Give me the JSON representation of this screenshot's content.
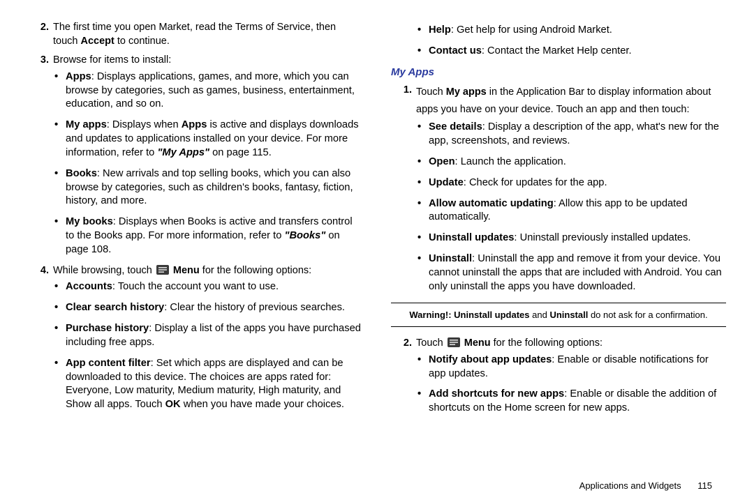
{
  "left": {
    "items": [
      {
        "num": "2.",
        "body_html": "The first time you open Market, read the Terms of Service, then touch <b>Accept</b> to continue."
      },
      {
        "num": "3.",
        "body_html": "Browse for items to install:",
        "bullets": [
          "<b>Apps</b>: Displays applications, games, and more, which you can browse by categories, such as games, business, entertainment, education, and so on.",
          "<b>My apps</b>: Displays when <b>Apps</b> is active and displays downloads and updates to applications installed on your device. For more information, refer to <i><b>\"My Apps\"</b></i> on page 115.",
          "<b>Books</b>: New arrivals and top selling books, which you can also browse by categories, such as children's books, fantasy, fiction, history, and more.",
          "<b>My books</b>: Displays when Books is active and transfers control to the Books app. For more information, refer to <i><b>\"Books\"</b></i> on page 108."
        ]
      },
      {
        "num": "4.",
        "body_pre": "While browsing, touch ",
        "menu_label": "Menu",
        "body_post": " for the following options:",
        "bullets": [
          "<b>Accounts</b>: Touch the account you want to use.",
          "<b>Clear search history</b>: Clear the history of previous searches.",
          "<b>Purchase history</b>: Display a list of the apps you have purchased including free apps.",
          "<b>App content filter</b>: Set which apps are displayed and can be downloaded to this device. The choices are apps rated for: Everyone, Low maturity, Medium maturity, High maturity, and Show all apps. Touch <b>OK</b> when you have made your choices."
        ]
      }
    ]
  },
  "right_top_bullets": [
    "<b>Help</b>: Get help for using Android Market.",
    "<b>Contact us</b>: Contact the Market Help center."
  ],
  "section_heading": "My Apps",
  "right_numlist": [
    {
      "num": "1.",
      "body_html": "Touch <b>My apps</b> in the Application Bar to display information about apps you have on your device. Touch an app and then touch:",
      "bullets": [
        "<b>See details</b>: Display a description of the app, what's new for the app, screenshots, and reviews.",
        "<b>Open</b>: Launch the application.",
        "<b>Update</b>: Check for updates for the app.",
        "<b>Allow automatic updating</b>: Allow this app to be updated automatically.",
        "<b>Uninstall updates</b>: Uninstall previously installed updates.",
        "<b>Uninstall</b>: Uninstall the app and remove it from your device. You cannot uninstall the apps that are included with Android. You can only uninstall the apps you have downloaded."
      ]
    },
    {
      "num": "2.",
      "body_pre": "Touch ",
      "menu_label": "Menu",
      "body_post": " for the following options:",
      "bullets": [
        "<b>Notify about app updates</b>: Enable or disable notifications for app updates.",
        "<b>Add shortcuts for new apps</b>: Enable or disable the addition of shortcuts on the Home screen for new apps."
      ]
    }
  ],
  "warning_html": "<b>Warning!: Uninstall updates</b> and <b>Uninstall</b> do not ask for a confirmation.",
  "footer": {
    "section": "Applications and Widgets",
    "page": "115"
  }
}
